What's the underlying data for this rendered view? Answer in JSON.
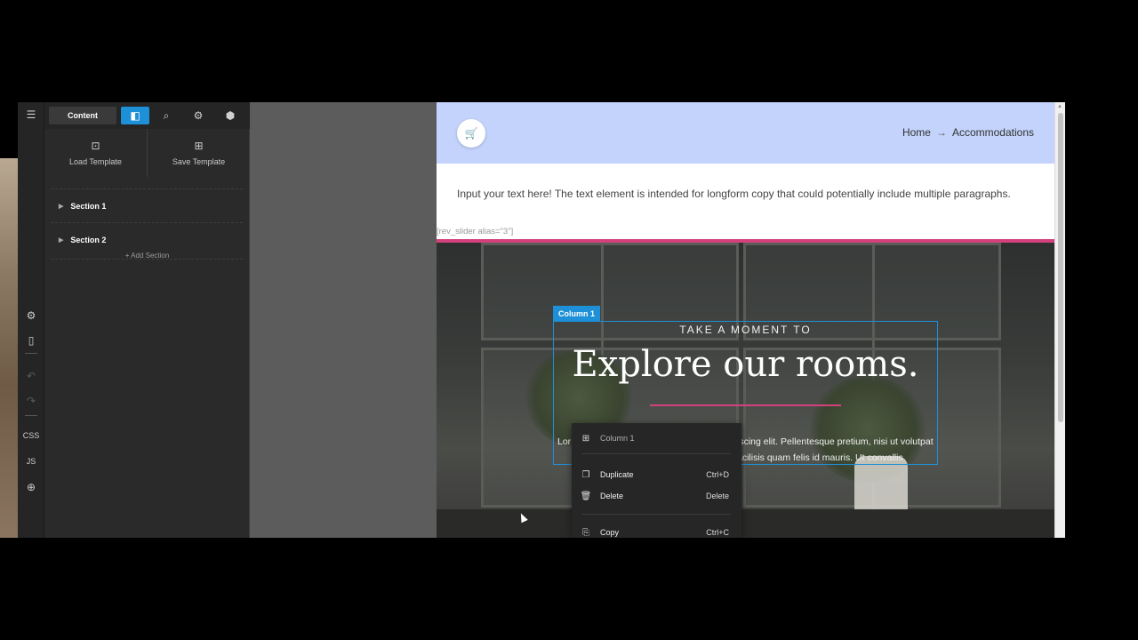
{
  "left_rail": {
    "items": [
      {
        "name": "hamburger-menu-icon",
        "glyph": "☰"
      },
      {
        "name": "cube-settings-icon",
        "glyph": "⚙"
      },
      {
        "name": "mobile-preview-icon",
        "glyph": "▯"
      },
      {
        "name": "undo-icon",
        "glyph": "↶"
      },
      {
        "name": "redo-icon",
        "glyph": "↷"
      }
    ],
    "css_label": "CSS",
    "js_label": "JS",
    "gamepad_glyph": "⊕"
  },
  "panel": {
    "tabs": {
      "content_label": "Content",
      "icons": [
        "◧",
        "⌕",
        "⚙",
        "⬢"
      ]
    },
    "templates": {
      "load_label": "Load Template",
      "save_label": "Save Template",
      "load_glyph": "⊡",
      "save_glyph": "⊞"
    },
    "sections": [
      {
        "label": "Section 1"
      },
      {
        "label": "Section 2"
      }
    ],
    "add_section_label": "+ Add Section"
  },
  "page": {
    "header": {
      "cart_glyph": "🛒",
      "breadcrumb": {
        "home": "Home",
        "arrow": "→",
        "current": "Accommodations"
      }
    },
    "text_element": "Input your text here! The text element is intended for longform copy that could potentially include multiple paragraphs.",
    "rev_slider": "[rev_slider alias=\"3\"]",
    "hero": {
      "column_tag": "Column 1",
      "kicker": "TAKE A MOMENT TO",
      "headline": "Explore our rooms.",
      "body_left": "Lor",
      "body_right_1": "iscing elit. Pellentesque pretium, nisi ut volutpat",
      "body_right_2": "acilisis quam felis id mauris. Ut convallis."
    }
  },
  "context_menu": {
    "header": {
      "glyph": "⊞",
      "label": "Column 1"
    },
    "items": [
      {
        "glyph": "❐",
        "label": "Duplicate",
        "shortcut": "Ctrl+D"
      },
      {
        "glyph": "🗑",
        "label": "Delete",
        "shortcut": "Delete"
      },
      {
        "glyph": "⎘",
        "label": "Copy",
        "shortcut": "Ctrl+C"
      }
    ]
  },
  "colors": {
    "accent_blue": "#1e90d8",
    "accent_pink": "#d4407b",
    "header_blue": "#c3d3fb"
  }
}
